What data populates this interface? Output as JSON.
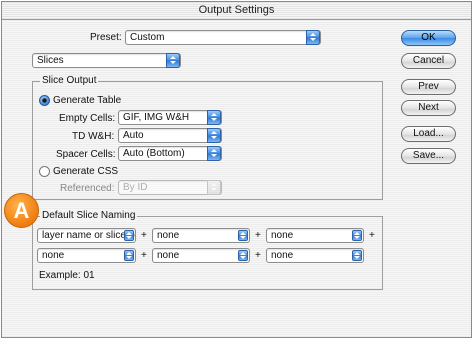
{
  "window": {
    "title": "Output Settings"
  },
  "preset": {
    "label": "Preset:",
    "value": "Custom"
  },
  "section_select": {
    "value": "Slices"
  },
  "slice_output": {
    "group_label": "Slice Output",
    "generate_table_label": "Generate Table",
    "empty_cells_label": "Empty Cells:",
    "empty_cells_value": "GIF, IMG W&H",
    "td_wh_label": "TD W&H:",
    "td_wh_value": "Auto",
    "spacer_cells_label": "Spacer Cells:",
    "spacer_cells_value": "Auto (Bottom)",
    "generate_css_label": "Generate CSS",
    "referenced_label": "Referenced:",
    "referenced_value": "By ID"
  },
  "naming": {
    "group_label": "Default Slice Naming",
    "row1": [
      "layer name or slice no.",
      "none",
      "none"
    ],
    "row2": [
      "none",
      "none",
      "none"
    ],
    "plus": "+",
    "example": "Example: 01"
  },
  "buttons": {
    "ok": "OK",
    "cancel": "Cancel",
    "prev": "Prev",
    "next": "Next",
    "load": "Load...",
    "save": "Save..."
  },
  "badge": "A"
}
